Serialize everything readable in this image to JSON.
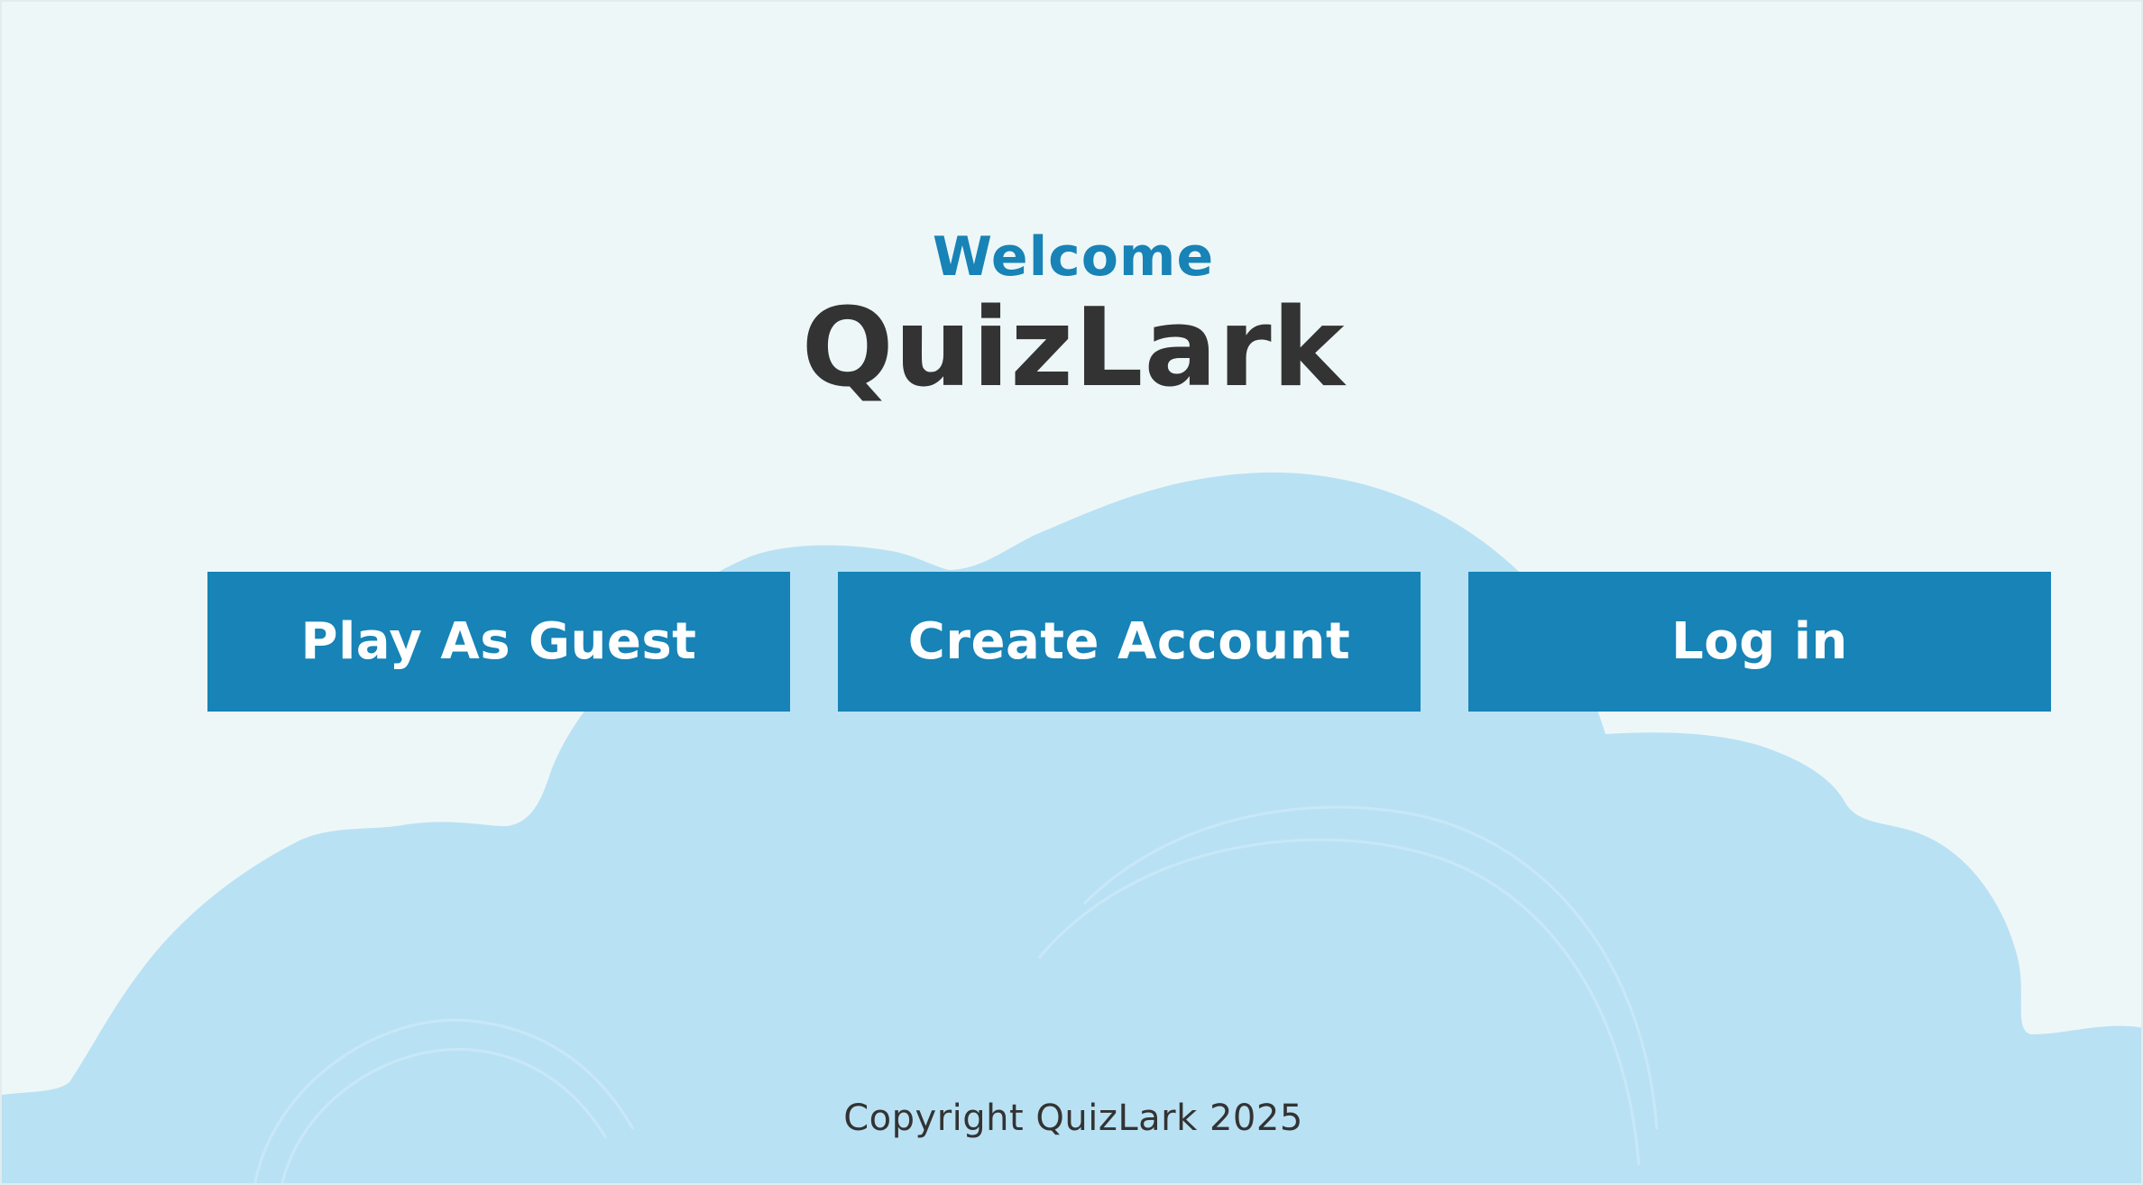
{
  "header": {
    "welcome": "Welcome",
    "brand": "QuizLark"
  },
  "buttons": {
    "guest": "Play As Guest",
    "create_account": "Create Account",
    "login": "Log in"
  },
  "footer": {
    "copyright": "Copyright QuizLark 2025"
  },
  "colors": {
    "background": "#eef7f8",
    "cloud": "#b9e1f4",
    "cloud_swirl": "#c8e8f7",
    "accent": "#1783b6",
    "brand_text": "#333333",
    "button_text": "#ffffff"
  }
}
